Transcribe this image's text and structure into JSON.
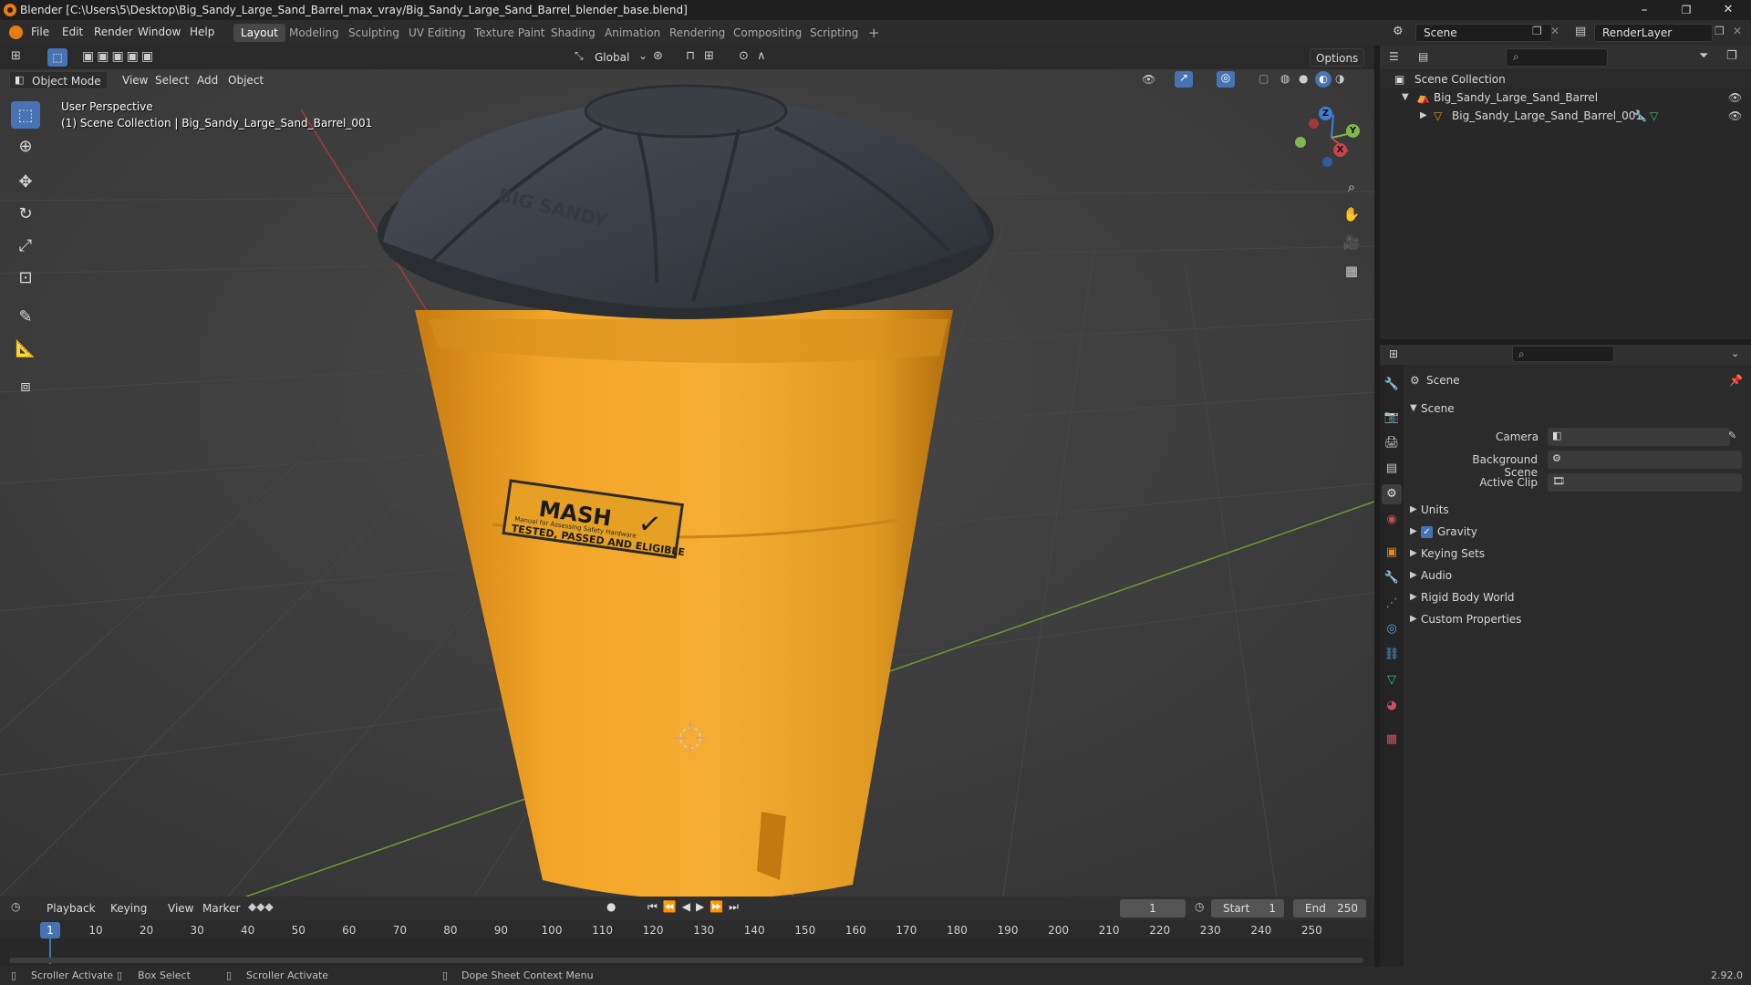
{
  "window": {
    "title": "Blender [C:\\Users\\5\\Desktop\\Big_Sandy_Large_Sand_Barrel_max_vray/Big_Sandy_Large_Sand_Barrel_blender_base.blend]",
    "controls": {
      "minimize": "–",
      "maximize": "❐",
      "close": "✕"
    }
  },
  "menu": {
    "items": [
      "File",
      "Edit",
      "Render",
      "Window",
      "Help"
    ],
    "workspaces": [
      "Layout",
      "Modeling",
      "Sculpting",
      "UV Editing",
      "Texture Paint",
      "Shading",
      "Animation",
      "Rendering",
      "Compositing",
      "Scripting"
    ],
    "add_workspace": "+",
    "scene_field": "Scene",
    "view_layer_field": "RenderLayer"
  },
  "viewport": {
    "mode": "Object Mode",
    "menus": [
      "View",
      "Select",
      "Add",
      "Object"
    ],
    "transform_orientation": "Global",
    "options_label": "Options",
    "perspective_label": "User Perspective",
    "collection_label": "(1) Scene Collection | Big_Sandy_Large_Sand_Barrel_001",
    "label_brand": "MASH",
    "label_line1": "Manual for Assessing Safety Hardware",
    "label_line2": "TESTED, PASSED AND ELIGIBLE",
    "lid_text": "BIG SANDY",
    "gizmo": {
      "z": "Z",
      "y": "Y",
      "x": "X"
    }
  },
  "outliner": {
    "root": "Scene Collection",
    "collection": "Big_Sandy_Large_Sand_Barrel",
    "object": "Big_Sandy_Large_Sand_Barrel_001"
  },
  "properties": {
    "context": "Scene",
    "panel_title": "Scene",
    "fields": {
      "camera": "Camera",
      "background_scene": "Background Scene",
      "active_clip": "Active Clip"
    },
    "subpanels": [
      "Units",
      "Gravity",
      "Keying Sets",
      "Audio",
      "Rigid Body World",
      "Custom Properties"
    ],
    "gravity_checked": true
  },
  "timeline": {
    "menus": [
      "Playback",
      "Keying",
      "View",
      "Marker"
    ],
    "current_frame": "1",
    "start_label": "Start",
    "start_value": "1",
    "end_label": "End",
    "end_value": "250",
    "ticks": [
      "1",
      "10",
      "20",
      "30",
      "40",
      "50",
      "60",
      "70",
      "80",
      "90",
      "100",
      "110",
      "120",
      "130",
      "140",
      "150",
      "160",
      "170",
      "180",
      "190",
      "200",
      "210",
      "220",
      "230",
      "240",
      "250"
    ]
  },
  "statusbar": {
    "items": [
      "Scroller Activate",
      "Box Select",
      "Scroller Activate",
      "Dope Sheet Context Menu"
    ],
    "version": "2.92.0"
  },
  "colors": {
    "accent": "#4772b3",
    "barrel_orange": "#f0a020",
    "lid_dark": "#3a3f46",
    "x_axis": "#c8454d",
    "y_axis": "#7fb84a",
    "z_axis": "#3f7fd6"
  }
}
